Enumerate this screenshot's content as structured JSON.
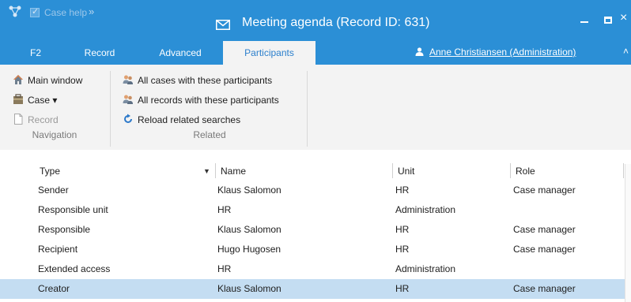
{
  "titlebar": {
    "casehelp_label": "Case help",
    "more_glyph": "»",
    "title": "Meeting agenda (Record ID: 631)",
    "close_glyph": "×",
    "bg_color": "#2b8fd6"
  },
  "tabs": {
    "items": [
      "F2",
      "Record",
      "Advanced",
      "Participants"
    ],
    "active": "Participants",
    "user": "Anne Christiansen (Administration)",
    "caret": "˄"
  },
  "ribbon": {
    "navigation": {
      "main_window": "Main window",
      "case": "Case ▾",
      "record": "Record",
      "group_label": "Navigation"
    },
    "related": {
      "all_cases": "All cases with these participants",
      "all_records": "All records with these participants",
      "reload": "Reload related searches",
      "group_label": "Related"
    }
  },
  "grid": {
    "columns": [
      "Type",
      "Name",
      "Unit",
      "Role"
    ],
    "sort_indicator": "▼",
    "rows": [
      {
        "type": "Sender",
        "name": "Klaus Salomon",
        "unit": "HR",
        "role": "Case manager"
      },
      {
        "type": "Responsible unit",
        "name": "HR",
        "unit": "Administration",
        "role": ""
      },
      {
        "type": "Responsible",
        "name": "Klaus Salomon",
        "unit": "HR",
        "role": "Case manager"
      },
      {
        "type": "Recipient",
        "name": "Hugo Hugosen",
        "unit": "HR",
        "role": "Case manager"
      },
      {
        "type": "Extended access",
        "name": "HR",
        "unit": "Administration",
        "role": ""
      },
      {
        "type": "Creator",
        "name": "Klaus Salomon",
        "unit": "HR",
        "role": "Case manager"
      }
    ],
    "selected_row": 5,
    "selected_color": "#c4ddf2"
  }
}
